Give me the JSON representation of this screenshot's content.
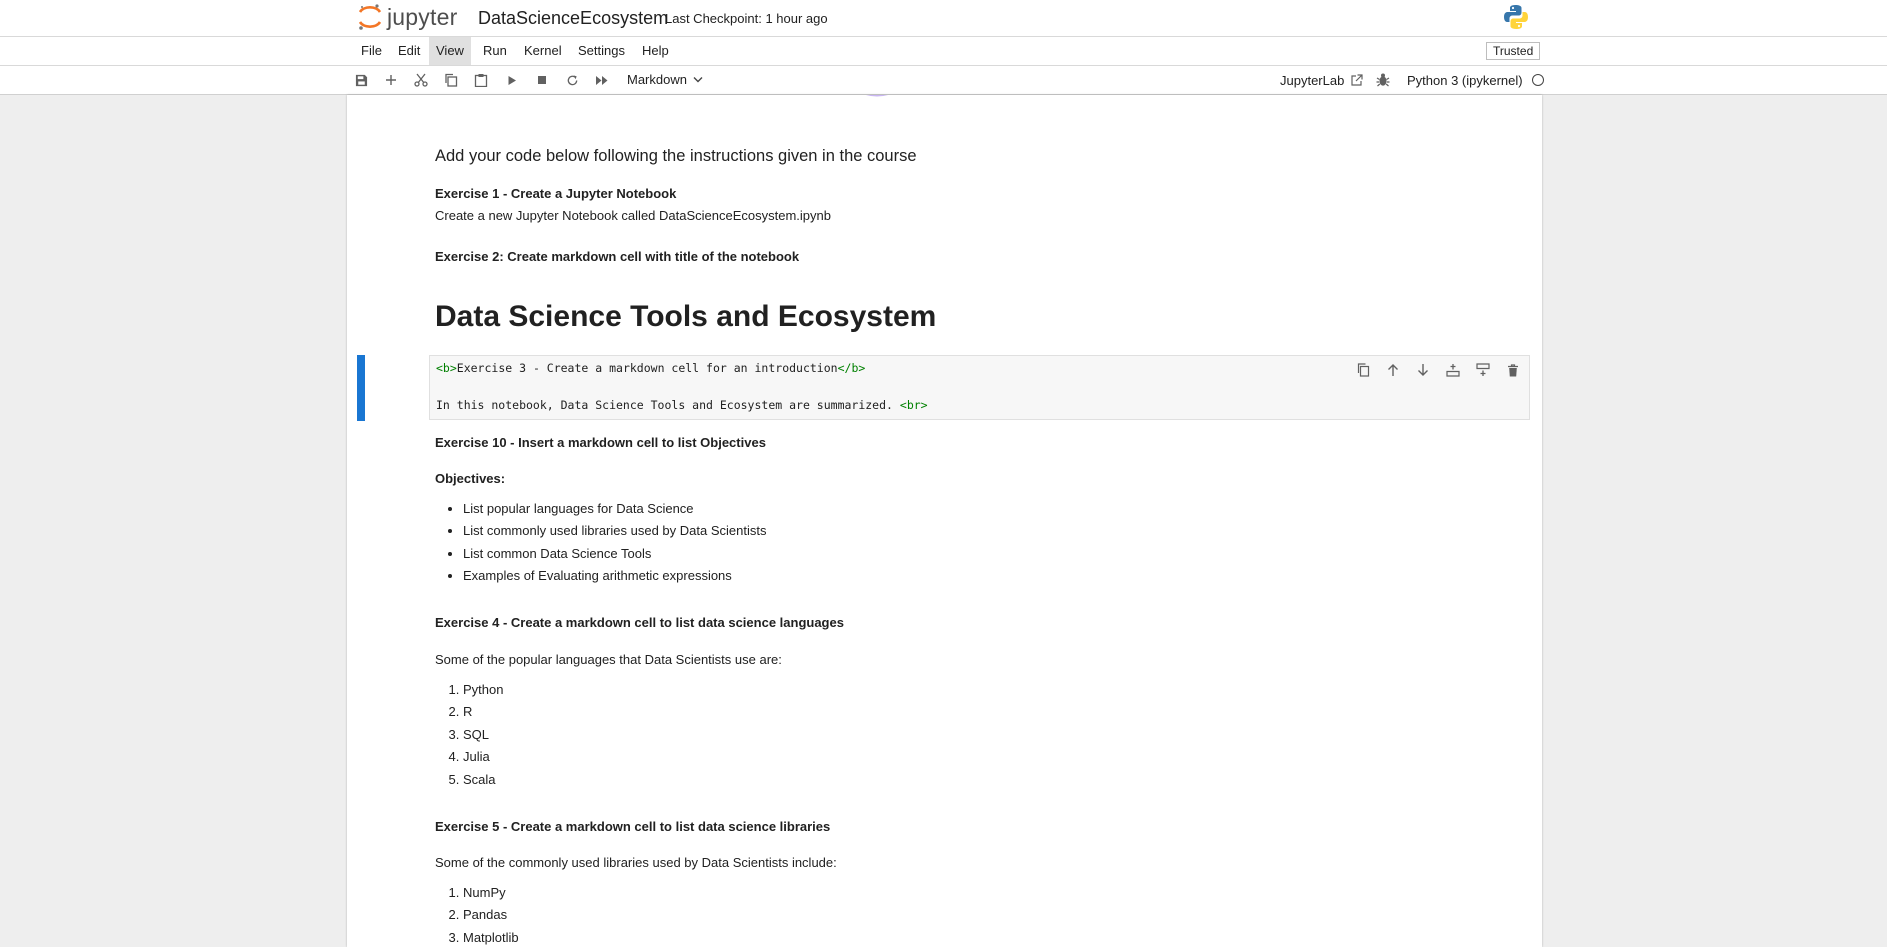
{
  "topbar": {
    "logo_text": "jupyter",
    "notebook_title": "DataScienceEcosystem",
    "checkpoint": "Last Checkpoint: 1 hour ago",
    "kernel_logo_icon": "python-logo-icon"
  },
  "menu": {
    "items": [
      "File",
      "Edit",
      "View",
      "Run",
      "Kernel",
      "Settings",
      "Help"
    ],
    "active": "View",
    "trusted_label": "Trusted"
  },
  "toolbar": {
    "icons": [
      "save-icon",
      "add-cell-icon",
      "cut-icon",
      "copy-icon",
      "paste-icon",
      "run-icon",
      "stop-icon",
      "restart-icon",
      "run-all-icon"
    ],
    "cell_type": "Markdown",
    "jupyterlab_label": "JupyterLab",
    "kernel_name": "Python 3 (ipykernel)"
  },
  "notebook": {
    "intro_heading": "Add your code below following the instructions given in the course",
    "ex1_title": "Exercise 1 - Create a Jupyter Notebook",
    "ex1_text": "Create a new Jupyter Notebook called DataScienceEcosystem.ipynb",
    "ex2_title": "Exercise 2: Create markdown cell with title of the notebook",
    "main_title": "Data Science Tools and Ecosystem",
    "active_cell": {
      "line1_open": "<b>",
      "line1_text": "Exercise 3 - Create a markdown cell for an introduction",
      "line1_close": "</b>",
      "line2_text": "In this notebook, Data Science Tools and Ecosystem are summarized. ",
      "line2_tag": "<br>"
    },
    "ex10_title": "Exercise 10 - Insert a markdown cell to list Objectives",
    "objectives_label": "Objectives:",
    "objectives": [
      "List popular languages for Data Science",
      "List commonly used libraries used by Data Scientists",
      "List common Data Science Tools",
      "Examples of Evaluating arithmetic expressions"
    ],
    "ex4_title": "Exercise 4 - Create a markdown cell to list data science languages",
    "ex4_text": "Some of the popular languages that Data Scientists use are:",
    "languages": [
      "Python",
      "R",
      "SQL",
      "Julia",
      "Scala"
    ],
    "ex5_title": "Exercise 5 - Create a markdown cell to list data science libraries",
    "ex5_text": "Some of the commonly used libraries used by Data Scientists include:",
    "libraries": [
      "NumPy",
      "Pandas",
      "Matplotlib"
    ]
  },
  "colors": {
    "accent_blue": "#1976d2",
    "jupyter_orange": "#f37626",
    "tag_green": "#008000"
  }
}
